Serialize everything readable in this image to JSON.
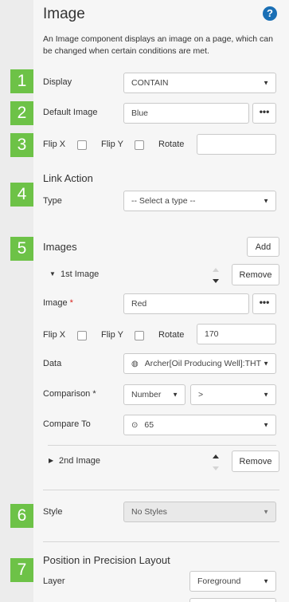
{
  "header": {
    "title": "Image",
    "help_label": "?",
    "description": "An Image component displays an image on a page, which can be changed when certain conditions are met."
  },
  "steps": [
    "1",
    "2",
    "3",
    "4",
    "5",
    "6",
    "7"
  ],
  "display": {
    "label": "Display",
    "value": "CONTAIN"
  },
  "default_image": {
    "label": "Default Image",
    "value": "Blue",
    "more": "•••"
  },
  "flip_rotate": {
    "flip_x": "Flip X",
    "flip_y": "Flip Y",
    "rotate": "Rotate",
    "rotate_value": ""
  },
  "link_action": {
    "title": "Link Action",
    "type_label": "Type",
    "type_value": "-- Select a type --"
  },
  "images": {
    "title": "Images",
    "add_label": "Add",
    "first": {
      "header": "1st Image",
      "remove_label": "Remove",
      "image_label": "Image",
      "required_mark": "*",
      "image_value": "Red",
      "more": "•••",
      "flip_x": "Flip X",
      "flip_y": "Flip Y",
      "rotate": "Rotate",
      "rotate_value": "170",
      "data_label": "Data",
      "data_value": "Archer[Oil Producing Well]:THT",
      "comparison_label": "Comparison",
      "comparison_type": "Number",
      "comparison_op": ">",
      "compare_to_label": "Compare To",
      "compare_to_value": "65"
    },
    "second": {
      "header": "2nd Image",
      "remove_label": "Remove"
    }
  },
  "style": {
    "label": "Style",
    "value": "No Styles"
  },
  "position": {
    "title": "Position in Precision Layout",
    "layer_label": "Layer",
    "layer_value": "Foreground"
  },
  "icons": {
    "help": "help-icon",
    "caret": "chevron-down-icon",
    "expand": "triangle-icon",
    "data": "data-source-icon",
    "compare": "target-icon"
  },
  "colors": {
    "step_badge": "#6dc247",
    "help": "#1a6fb5",
    "required": "#d9231d",
    "panel": "#f6f6f6",
    "sidebar": "#ececec"
  }
}
